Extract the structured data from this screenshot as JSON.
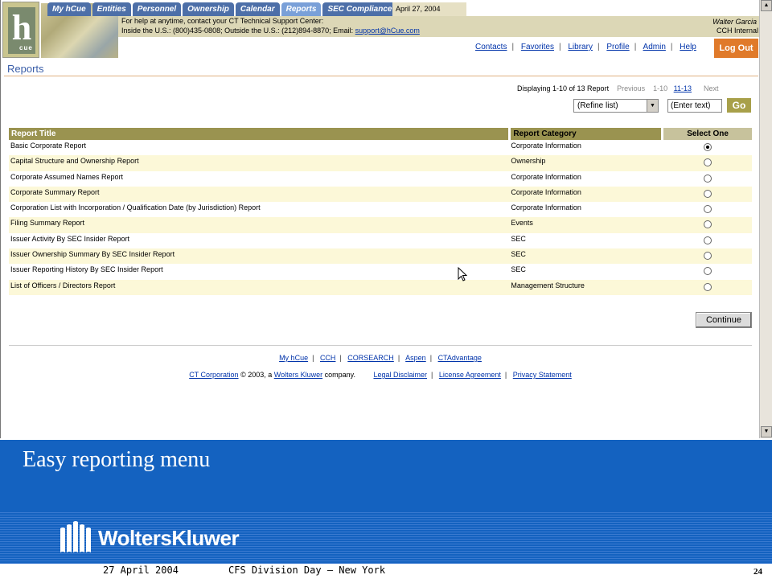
{
  "tabs": [
    "My hCue",
    "Entities",
    "Personnel",
    "Ownership",
    "Calendar",
    "Reports",
    "SEC Compliance"
  ],
  "active_tab": "Reports",
  "header_date": "April 27, 2004",
  "help": {
    "line1": "For help at anytime, contact your CT Technical Support Center:",
    "line2_prefix": "Inside the U.S.: (800)435-0808; Outside the U.S.: (212)894-8870; Email: ",
    "email": "support@hCue.com"
  },
  "user": {
    "name": "Walter Garcia",
    "org": "CCH Internal"
  },
  "logo_letter": "h",
  "logo_sub": "cue",
  "top_links": [
    "Contacts",
    "Favorites",
    "Library",
    "Profile",
    "Admin",
    "Help"
  ],
  "logout_label": "Log Out",
  "page_title": "Reports",
  "paging": {
    "status": "Displaying 1-10 of 13 Report",
    "previous": "Previous",
    "current": "1-10",
    "next_range": "11-13",
    "next": "Next"
  },
  "refine": {
    "value": "(Refine list)",
    "text_value": "(Enter text)",
    "go": "Go"
  },
  "table": {
    "headers": [
      "Report Title",
      "Report Category",
      "Select One"
    ],
    "rows": [
      {
        "title": "Basic Corporate Report",
        "category": "Corporate Information",
        "selected": true
      },
      {
        "title": "Capital Structure and Ownership Report",
        "category": "Ownership",
        "selected": false
      },
      {
        "title": "Corporate Assumed Names Report",
        "category": "Corporate Information",
        "selected": false
      },
      {
        "title": "Corporate Summary Report",
        "category": "Corporate Information",
        "selected": false
      },
      {
        "title": "Corporation List with Incorporation / Qualification Date (by Jurisdiction) Report",
        "category": "Corporate Information",
        "selected": false
      },
      {
        "title": "Filing Summary Report",
        "category": "Events",
        "selected": false
      },
      {
        "title": "Issuer Activity By SEC Insider Report",
        "category": "SEC",
        "selected": false
      },
      {
        "title": "Issuer Ownership Summary By SEC Insider Report",
        "category": "SEC",
        "selected": false
      },
      {
        "title": "Issuer Reporting History By SEC Insider Report",
        "category": "SEC",
        "selected": false
      },
      {
        "title": "List of Officers / Directors Report",
        "category": "Management Structure",
        "selected": false
      }
    ]
  },
  "continue_label": "Continue",
  "footer": {
    "links1": [
      "My hCue",
      "CCH",
      "CORSEARCH",
      "Aspen",
      "CTAdvantage"
    ],
    "ct_corp": "CT Corporation",
    "copyright_mid": " © 2003, a ",
    "wk": "Wolters Kluwer",
    "company": " company.",
    "links2": [
      "Legal Disclaimer",
      "License Agreement",
      "Privacy Statement"
    ]
  },
  "slide": {
    "caption": "Easy reporting menu",
    "brand": "WoltersKluwer",
    "date": "27 April 2004",
    "event": "CFS Division Day – New York",
    "page": "24"
  },
  "colors": {
    "accent_blue": "#1462c0",
    "logout_orange": "#e07a2a",
    "table_header": "#9a9350",
    "row_alt": "#fcf8d8"
  }
}
